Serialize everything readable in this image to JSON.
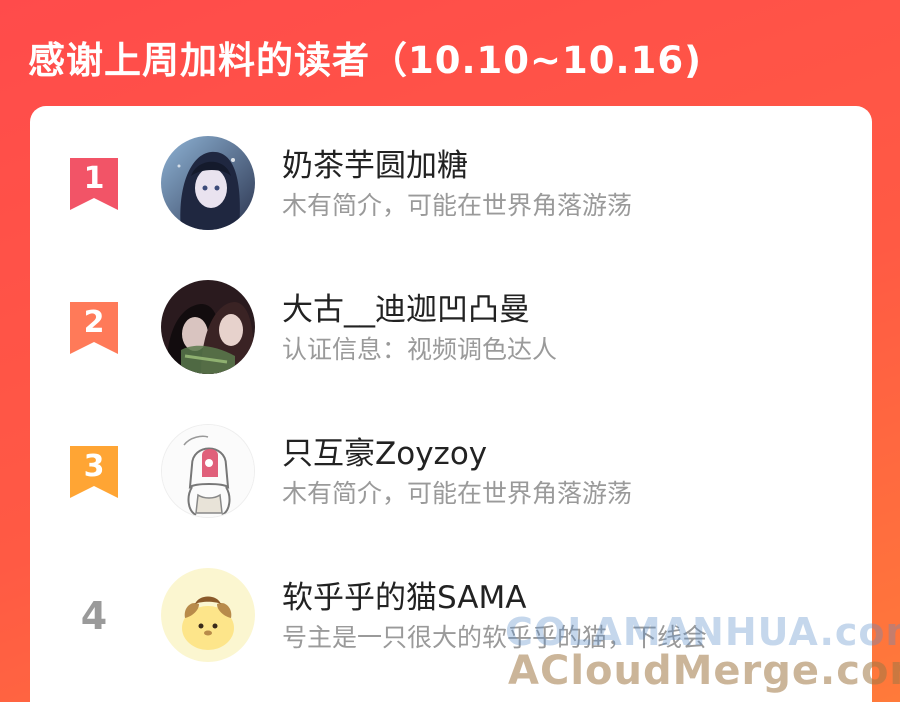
{
  "header": {
    "title": "感谢上周加料的读者（10.10~10.16)"
  },
  "readers": [
    {
      "rank": "1",
      "name": "奶茶芋圆加糖",
      "desc": "木有简介，可能在世界角落游荡",
      "badge_color": "#f25467",
      "avatar": "anime-girl-dark-hair-avatar"
    },
    {
      "rank": "2",
      "name": "大古__迪迦凹凸曼",
      "desc": "认证信息：视频调色达人",
      "badge_color": "#ff7a59",
      "avatar": "anime-couple-avatar"
    },
    {
      "rank": "3",
      "name": "只互豪Zoyzoy",
      "desc": "木有简介，可能在世界角落游荡",
      "badge_color": "#ffa534",
      "avatar": "hooded-character-sketch-avatar"
    },
    {
      "rank": "4",
      "name": "软乎乎的猫SAMA",
      "desc": "号主是一只很大的软乎乎的猫，下线会",
      "badge_color": "#9a9a9a",
      "avatar": "pompompurin-avatar"
    }
  ],
  "watermark": {
    "line1": "COLAMANHUA.com",
    "line2": "ACloudMerge.com"
  }
}
